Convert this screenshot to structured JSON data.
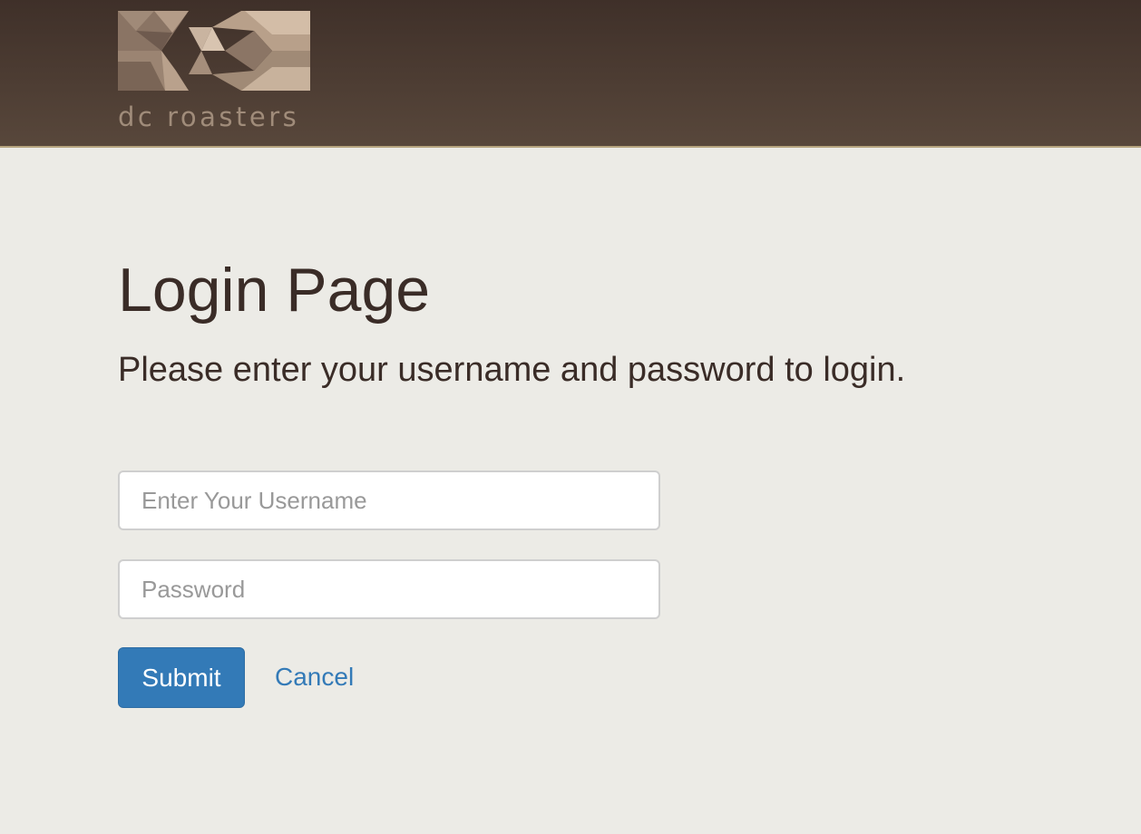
{
  "header": {
    "brand": {
      "logo_icon": "dc-roasters-logo-mark",
      "logo_text": "dc roasters"
    }
  },
  "main": {
    "title": "Login Page",
    "subtitle": "Please enter your username and password to login.",
    "form": {
      "username": {
        "value": "",
        "placeholder": "Enter Your Username"
      },
      "password": {
        "value": "",
        "placeholder": "Password"
      },
      "submit_label": "Submit",
      "cancel_label": "Cancel"
    }
  },
  "colors": {
    "header_bg_top": "#3f3029",
    "header_bg_bottom": "#58473b",
    "page_bg": "#ecebe6",
    "text": "#3a2c27",
    "accent": "#337ab7",
    "logo": "#a08c7a"
  }
}
